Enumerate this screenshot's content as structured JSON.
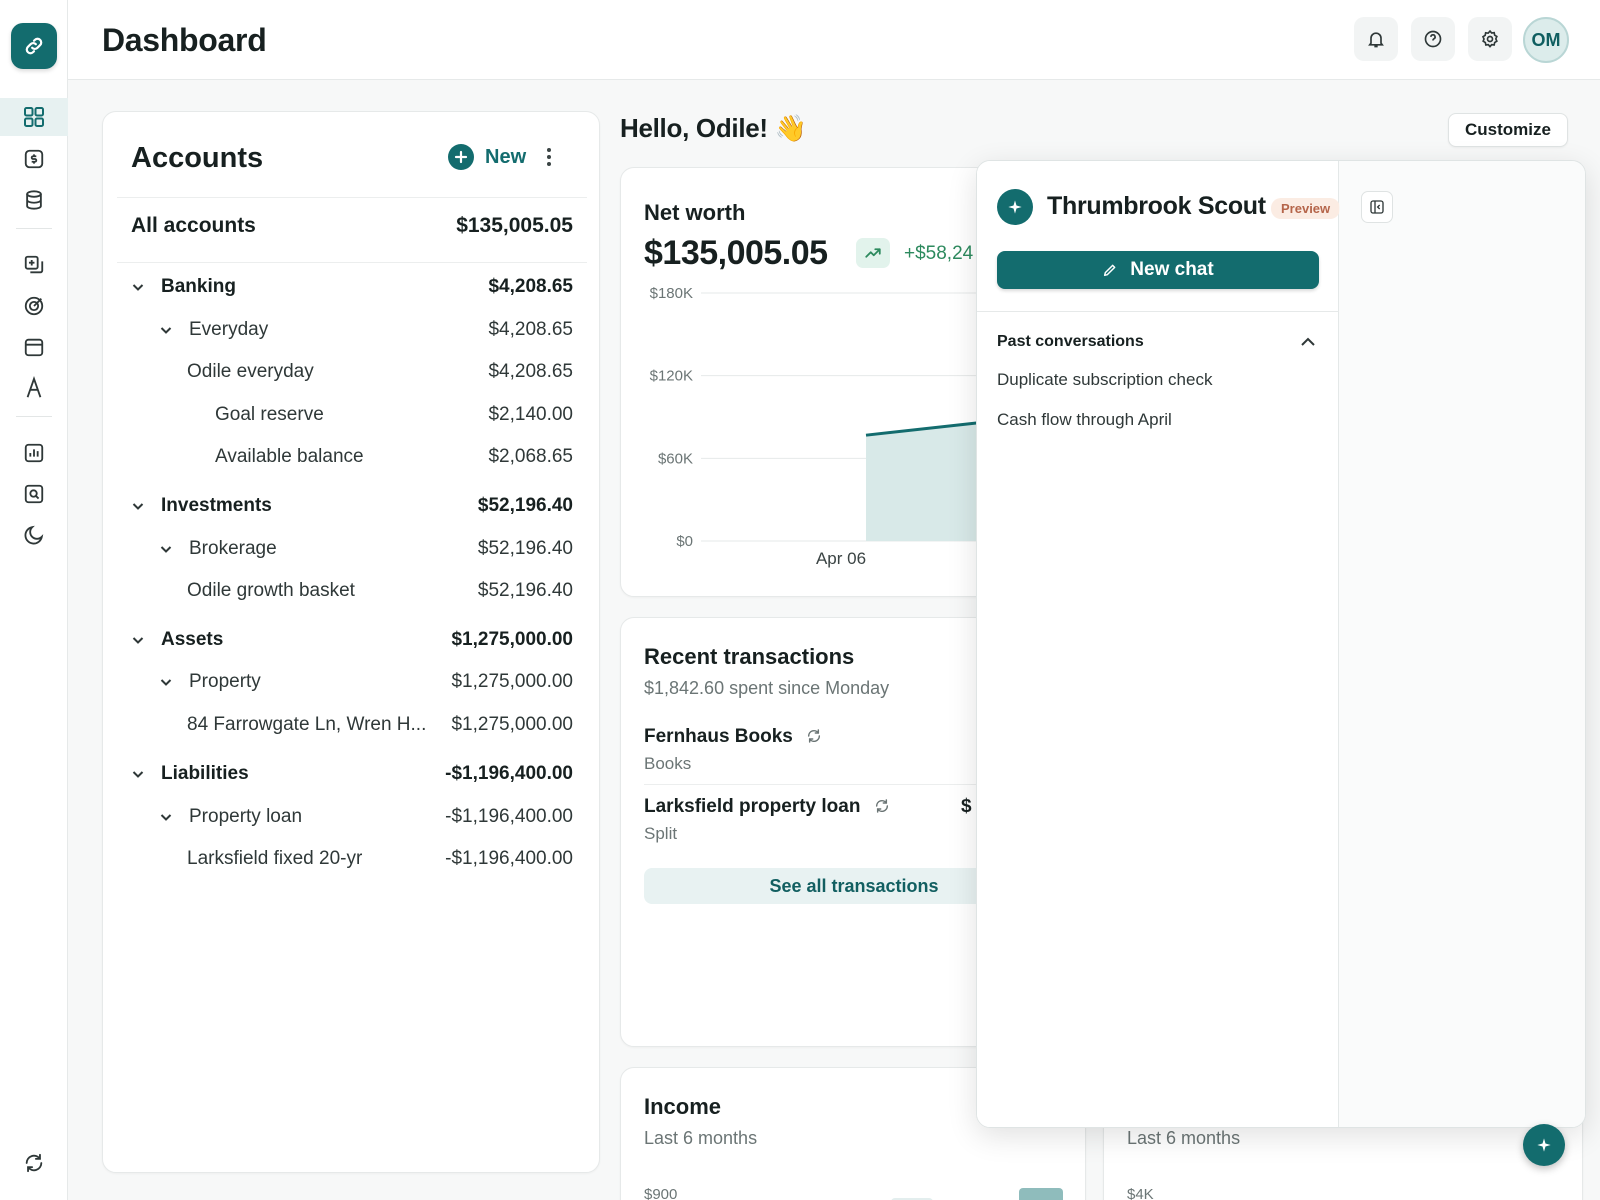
{
  "app": {
    "title": "Dashboard",
    "avatar_initials": "OM"
  },
  "colors": {
    "brand": "#136c6e",
    "positive": "#2d8a5e",
    "preview_bg": "#fbece3"
  },
  "sidebar": {
    "items": [
      {
        "icon": "grid-icon",
        "active": true
      },
      {
        "icon": "dollar-icon"
      },
      {
        "icon": "database-icon"
      },
      {
        "icon": "add-transaction-icon"
      },
      {
        "icon": "target-icon"
      },
      {
        "icon": "calendar-icon"
      },
      {
        "icon": "font-icon"
      },
      {
        "icon": "bar-chart-icon"
      },
      {
        "icon": "search-report-icon"
      },
      {
        "icon": "pie-icon"
      }
    ],
    "footer_icon": "sync-icon"
  },
  "topbar": {
    "buttons": [
      "bell-icon",
      "help-icon",
      "gear-icon"
    ]
  },
  "accounts": {
    "title": "Accounts",
    "new_label": "New",
    "all_label": "All accounts",
    "all_amount": "$135,005.05",
    "rows": [
      {
        "label": "Banking",
        "amount": "$4,208.65"
      },
      {
        "label": "Everyday",
        "amount": "$4,208.65"
      },
      {
        "label": "Odile everyday",
        "amount": "$4,208.65"
      },
      {
        "label": "Goal reserve",
        "amount": "$2,140.00"
      },
      {
        "label": "Available balance",
        "amount": "$2,068.65"
      },
      {
        "label": "Investments",
        "amount": "$52,196.40"
      },
      {
        "label": "Brokerage",
        "amount": "$52,196.40"
      },
      {
        "label": "Odile growth basket",
        "amount": "$52,196.40"
      },
      {
        "label": "Assets",
        "amount": "$1,275,000.00"
      },
      {
        "label": "Property",
        "amount": "$1,275,000.00"
      },
      {
        "label": "84 Farrowgate Ln, Wren H...",
        "amount": "$1,275,000.00"
      },
      {
        "label": "Liabilities",
        "amount": "-$1,196,400.00"
      },
      {
        "label": "Property loan",
        "amount": "-$1,196,400.00"
      },
      {
        "label": "Larksfield fixed 20-yr",
        "amount": "-$1,196,400.00"
      }
    ]
  },
  "greeting": "Hello, Odile! 👋",
  "customize_label": "Customize",
  "networth": {
    "title": "Net worth",
    "value": "$135,005.05",
    "change": "+$58,24",
    "trend_icon": "trend-up-icon"
  },
  "chart_data": {
    "type": "area",
    "title": "Net worth",
    "yticks": [
      "$180K",
      "$120K",
      "$60K",
      "$0"
    ],
    "ylim": [
      0,
      180000
    ],
    "xticks": [
      "Apr 06"
    ],
    "series": [
      {
        "values": [
          76800,
          86000
        ]
      }
    ],
    "grid": true
  },
  "recent": {
    "title": "Recent transactions",
    "subtitle": "$1,842.60 spent since Monday",
    "transactions": [
      {
        "name": "Fernhaus Books",
        "category": "Books",
        "amount": ""
      },
      {
        "name": "Larksfield property loan",
        "category": "Split",
        "amount": "$"
      }
    ],
    "see_all": "See all transactions"
  },
  "income": {
    "title": "Income",
    "subtitle": "Last 6 months",
    "tick": "$900"
  },
  "spending": {
    "subtitle": "Last 6 months",
    "tick": "$4K"
  },
  "scout": {
    "name": "Thrumbrook Scout",
    "badge": "Preview",
    "new_chat": "New chat",
    "past_title": "Past conversations",
    "conversations": [
      "Duplicate subscription check",
      "Cash flow through April"
    ]
  }
}
